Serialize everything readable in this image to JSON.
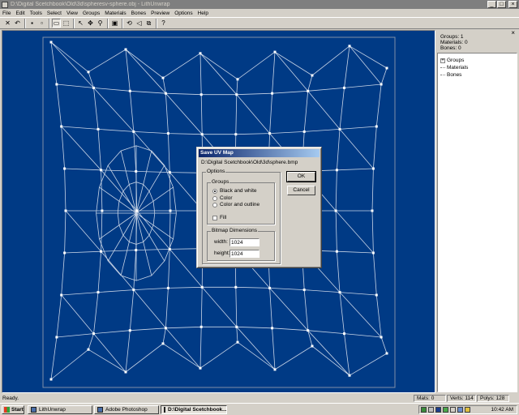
{
  "window": {
    "title": "D:\\Digital Scetchbook\\Old\\3d\\spheresv-sphere.obj - LithUnwrap",
    "minimize_glyph": "_",
    "maximize_glyph": "□",
    "close_glyph": "×"
  },
  "menu": [
    "File",
    "Edit",
    "Tools",
    "Select",
    "View",
    "Groups",
    "Materials",
    "Bones",
    "Preview",
    "Options",
    "Help"
  ],
  "toolbar": [
    {
      "name": "close-model-tool",
      "glyph": "✕"
    },
    {
      "name": "undo-tool",
      "glyph": "↶"
    },
    {
      "name": "sep"
    },
    {
      "name": "save-tool",
      "glyph": "▪"
    },
    {
      "name": "save-all-tool",
      "glyph": "▫"
    },
    {
      "name": "sep"
    },
    {
      "name": "select-rect-tool",
      "glyph": "▭",
      "pressed": true
    },
    {
      "name": "select-lasso-tool",
      "glyph": "⬚"
    },
    {
      "name": "sep"
    },
    {
      "name": "pointer-tool",
      "glyph": "↖"
    },
    {
      "name": "move-tool",
      "glyph": "✥"
    },
    {
      "name": "zoom-tool",
      "glyph": "⚲"
    },
    {
      "name": "sep"
    },
    {
      "name": "fit-tool",
      "glyph": "▣"
    },
    {
      "name": "sep"
    },
    {
      "name": "rotate-tool",
      "glyph": "⟲"
    },
    {
      "name": "scale-tool",
      "glyph": "◁"
    },
    {
      "name": "flip-tool",
      "glyph": "⧉"
    },
    {
      "name": "sep"
    },
    {
      "name": "help-tool",
      "glyph": "?"
    }
  ],
  "panel": {
    "groups": "Groups: 1",
    "materials": "Materials: 0",
    "bones": "Bones: 0",
    "close_glyph": "×",
    "tree": [
      {
        "label": "Groups",
        "toggle": "+"
      },
      {
        "label": "Materials"
      },
      {
        "label": "Bones"
      }
    ]
  },
  "dialog": {
    "title": "Save UV Map",
    "path": "D:\\Digital Scetchbook\\Old\\3d\\sphere.bmp",
    "options_label": "Options",
    "groups_label": "Groups",
    "radios": [
      {
        "label": "Black and white",
        "checked": true
      },
      {
        "label": "Color",
        "checked": false
      },
      {
        "label": "Color and outline",
        "checked": false
      }
    ],
    "fill_label": "Fill",
    "fill_checked": false,
    "bitmap_label": "Bitmap Dimensions",
    "width_label": "width:",
    "width_value": "1024",
    "height_label": "height:",
    "height_value": "1024",
    "ok_label": "OK",
    "cancel_label": "Cancel"
  },
  "status": {
    "message": "Ready.",
    "mats": "Mats: 0",
    "verts": "Verts: 114",
    "polys": "Polys: 128"
  },
  "taskbar": {
    "start_label": "Start",
    "tasks": [
      {
        "label": "LithUnwrap",
        "active": false
      },
      {
        "label": "Adobe Photoshop",
        "active": false
      },
      {
        "label": "D:\\Digital Scetchbook...",
        "active": true
      }
    ],
    "clock": "10:42 AM",
    "tray_icons": [
      "network-icon",
      "volume-icon",
      "antivirus-icon",
      "messenger-icon",
      "printer-icon",
      "monitor-icon",
      "speaker-icon"
    ]
  },
  "colors": {
    "canvas_bg": "#003a85",
    "uv_lines": "#c8d4e6",
    "border_line": "#7f8fa8"
  }
}
